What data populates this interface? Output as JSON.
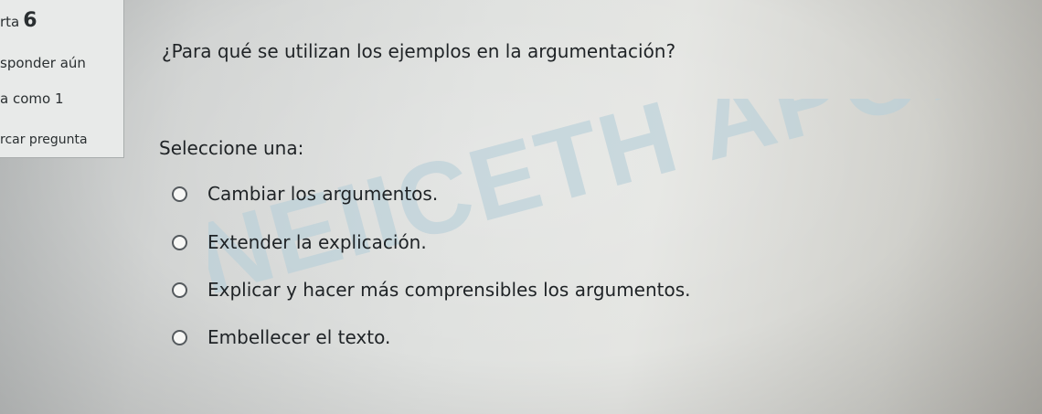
{
  "info": {
    "question_prefix": "rta",
    "question_number": "6",
    "status": "sponder aún",
    "marks": "a como 1",
    "flag_label": "rcar pregunta"
  },
  "question": {
    "text": "¿Para qué se utilizan los ejemplos en la argumentación?",
    "select_prompt": "Seleccione una:",
    "options": [
      {
        "label": "Cambiar los argumentos."
      },
      {
        "label": "Extender la explicación."
      },
      {
        "label": "Explicar y hacer más comprensibles los argumentos."
      },
      {
        "label": "Embellecer el texto."
      }
    ]
  },
  "watermark": {
    "text": "NEIICETH APONTE IE"
  }
}
